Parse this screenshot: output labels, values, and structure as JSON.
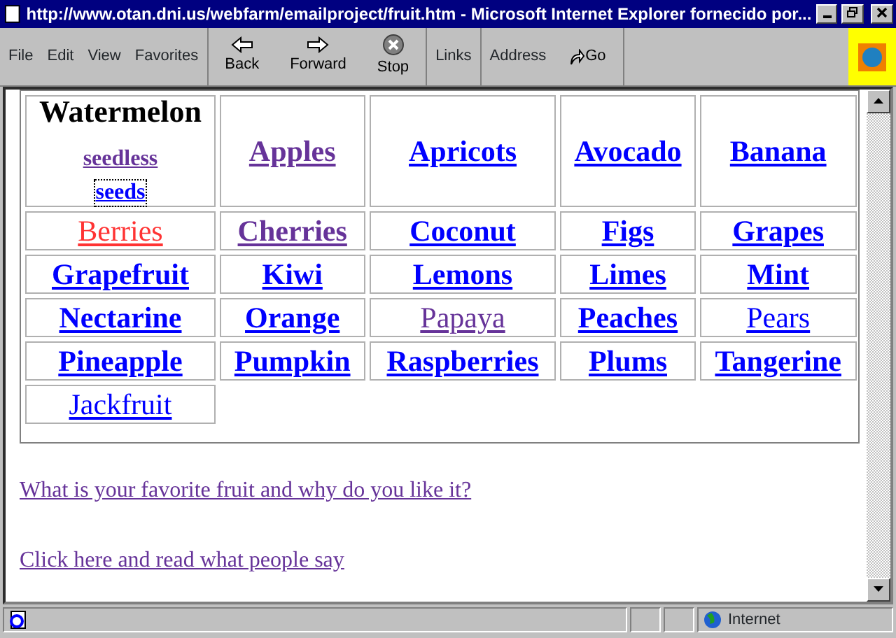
{
  "window": {
    "title": "http://www.otan.dni.us/webfarm/emailproject/fruit.htm - Microsoft Internet Explorer fornecido por..."
  },
  "menu": [
    "File",
    "Edit",
    "View",
    "Favorites"
  ],
  "toolbar": [
    {
      "label": "Back",
      "kind": "back"
    },
    {
      "label": "Forward",
      "kind": "forward"
    },
    {
      "label": "Stop",
      "kind": "stop"
    }
  ],
  "links_label": "Links",
  "address_label": "Address",
  "go_label": "Go",
  "first_cell": {
    "heading": "Watermelon",
    "links": [
      {
        "text": "seedless",
        "visited": true,
        "focused": false
      },
      {
        "text": "seeds",
        "visited": false,
        "focused": true
      }
    ]
  },
  "fruits": [
    {
      "text": "Apples",
      "visited": true,
      "active": false,
      "bold": true
    },
    {
      "text": "Apricots",
      "visited": false,
      "active": false,
      "bold": true
    },
    {
      "text": "Avocado",
      "visited": false,
      "active": false,
      "bold": true
    },
    {
      "text": "Banana",
      "visited": false,
      "active": false,
      "bold": true
    },
    {
      "text": "Berries",
      "visited": false,
      "active": true,
      "bold": false
    },
    {
      "text": "Cherries",
      "visited": true,
      "active": false,
      "bold": true
    },
    {
      "text": "Coconut",
      "visited": false,
      "active": false,
      "bold": true
    },
    {
      "text": "Figs",
      "visited": false,
      "active": false,
      "bold": true
    },
    {
      "text": "Grapes",
      "visited": false,
      "active": false,
      "bold": true
    },
    {
      "text": "Grapefruit",
      "visited": false,
      "active": false,
      "bold": true
    },
    {
      "text": "Kiwi",
      "visited": false,
      "active": false,
      "bold": true
    },
    {
      "text": "Lemons",
      "visited": false,
      "active": false,
      "bold": true
    },
    {
      "text": "Limes",
      "visited": false,
      "active": false,
      "bold": true
    },
    {
      "text": "Mint",
      "visited": false,
      "active": false,
      "bold": true
    },
    {
      "text": "Nectarine",
      "visited": false,
      "active": false,
      "bold": true
    },
    {
      "text": "Orange",
      "visited": false,
      "active": false,
      "bold": true
    },
    {
      "text": "Papaya",
      "visited": true,
      "active": false,
      "bold": false
    },
    {
      "text": "Peaches",
      "visited": false,
      "active": false,
      "bold": true
    },
    {
      "text": "Pears",
      "visited": false,
      "active": false,
      "bold": false
    },
    {
      "text": "Pineapple",
      "visited": false,
      "active": false,
      "bold": true
    },
    {
      "text": "Pumpkin",
      "visited": false,
      "active": false,
      "bold": true
    },
    {
      "text": "Raspberries",
      "visited": false,
      "active": false,
      "bold": true
    },
    {
      "text": "Plums",
      "visited": false,
      "active": false,
      "bold": true
    },
    {
      "text": "Tangerine",
      "visited": false,
      "active": false,
      "bold": true
    },
    {
      "text": "Jackfruit",
      "visited": false,
      "active": false,
      "bold": false
    }
  ],
  "page_links": [
    {
      "text": "What is your favorite fruit and why do you like it?",
      "visited": true
    },
    {
      "text": "Click here and read what people say",
      "visited": true
    }
  ],
  "status_bar": {
    "zone": "Internet"
  }
}
